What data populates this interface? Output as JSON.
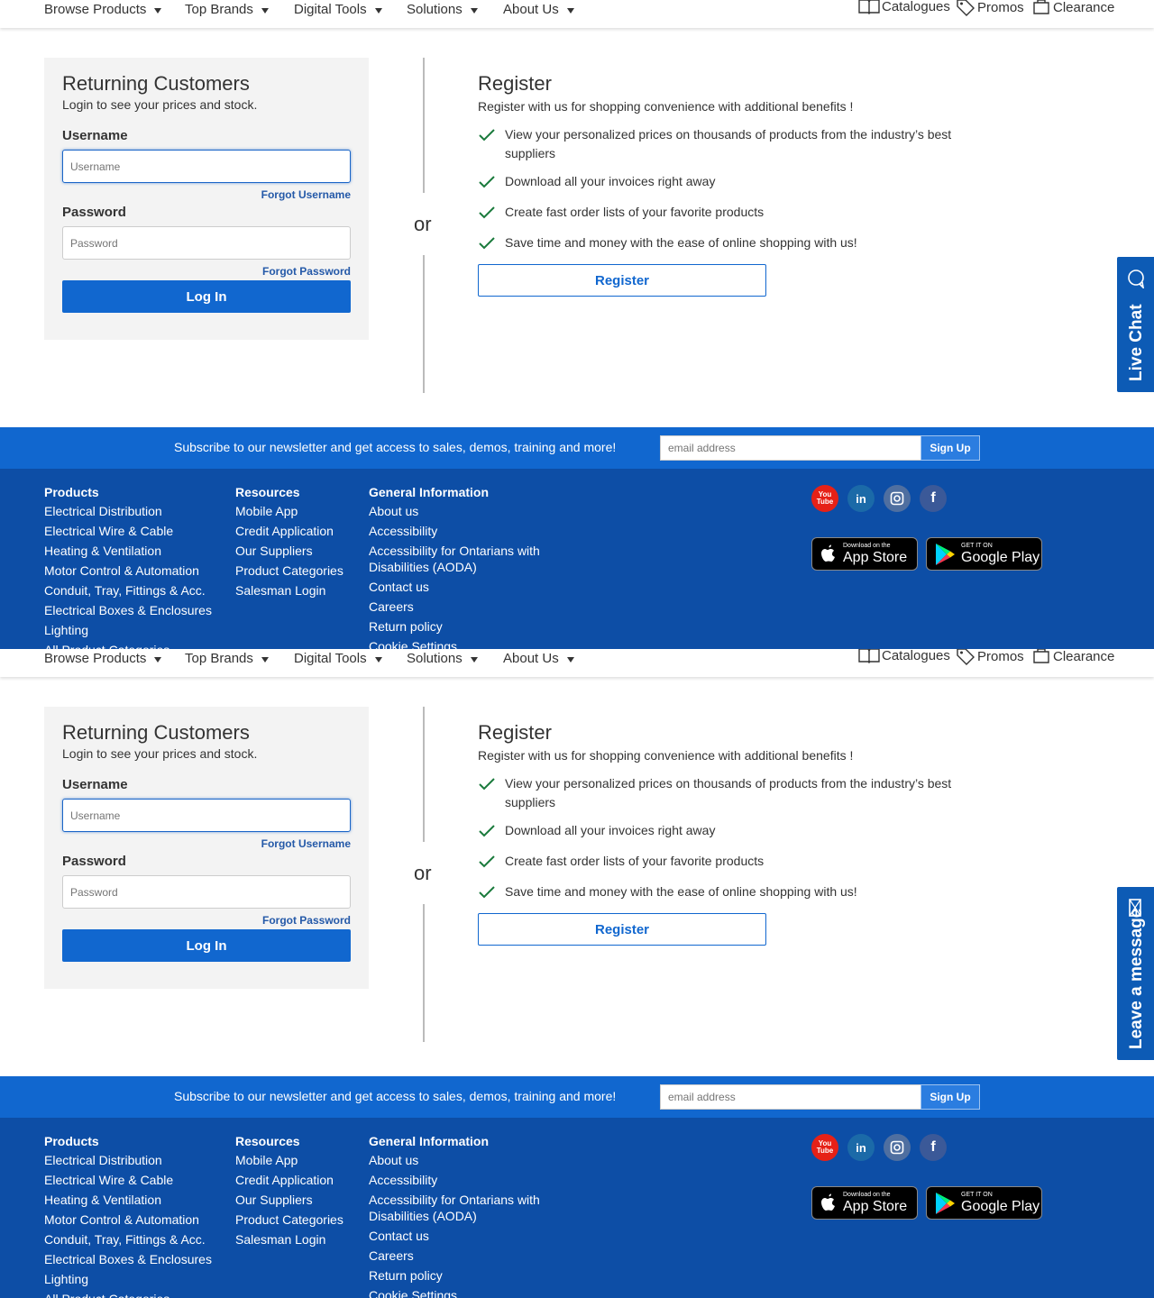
{
  "nav": {
    "items": [
      "Browse Products",
      "Top Brands",
      "Digital Tools",
      "Solutions",
      "About Us"
    ],
    "utils": [
      "Catalogues",
      "Promos",
      "Clearance"
    ]
  },
  "login": {
    "title": "Returning Customers",
    "subtitle": "Login to see your prices and stock.",
    "username_label": "Username",
    "username_placeholder": "Username",
    "forgot_username": "Forgot Username",
    "password_label": "Password",
    "password_placeholder": "Password",
    "forgot_password": "Forgot Password",
    "login_button": "Log In"
  },
  "divider": {
    "or": "or"
  },
  "register": {
    "title": "Register",
    "subtitle": "Register with us for shopping convenience with additional benefits !",
    "benefits": [
      "View your personalized prices on thousands of products from the industry’s best suppliers",
      "Download all your invoices right away",
      "Create fast order lists of your favorite products",
      "Save time and money with the ease of online shopping with us!"
    ],
    "button": "Register"
  },
  "sidetab": {
    "frame1": "Live Chat",
    "frame2": "Leave a message"
  },
  "newsletter": {
    "text": "Subscribe to our newsletter and get access to sales, demos, training and more!",
    "placeholder": "email address",
    "button": "Sign Up"
  },
  "footer": {
    "products": {
      "heading": "Products",
      "links": [
        "Electrical Distribution",
        "Electrical Wire & Cable",
        "Heating & Ventilation",
        "Motor Control & Automation",
        "Conduit, Tray, Fittings & Acc.",
        "Electrical Boxes & Enclosures",
        "Lighting",
        "All Product Categories"
      ]
    },
    "resources": {
      "heading": "Resources",
      "links": [
        "Mobile App",
        "Credit Application",
        "Our Suppliers",
        "Product Categories",
        "Salesman Login"
      ]
    },
    "general": {
      "heading": "General Information",
      "links": [
        "About us",
        "Accessibility",
        "Accessibility for Ontarians with Disabilities (AODA)",
        "Contact us",
        "Careers",
        "Return policy",
        "Cookie Settings"
      ]
    },
    "social": {
      "youtube": "You Tube",
      "linkedin": "in"
    },
    "appstore": {
      "small": "Download on the",
      "big": "App Store"
    },
    "googleplay": {
      "small": "GET IT ON",
      "big": "Google Play"
    }
  },
  "colors": {
    "brand_blue": "#1167cf",
    "footer_blue": "#0d4ea6",
    "check_green": "#1a7a3c"
  }
}
